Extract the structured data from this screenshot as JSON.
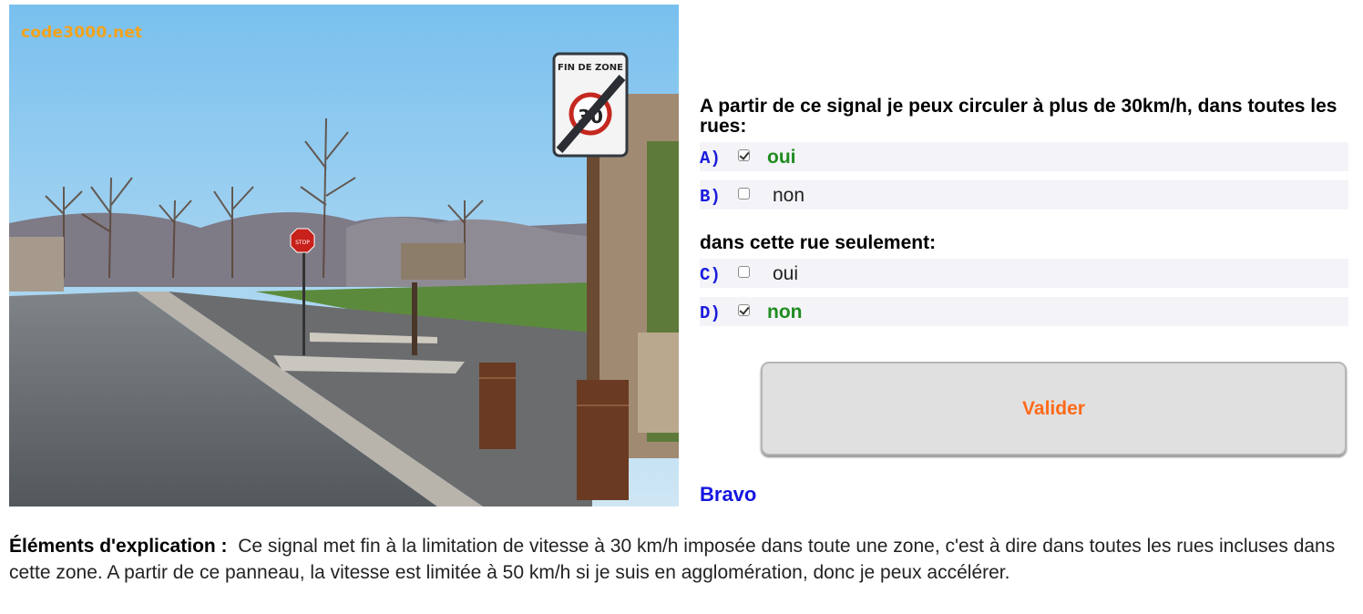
{
  "image": {
    "watermark": "code3000.net",
    "sign_top_text": "FIN DE ZONE",
    "sign_number": "30",
    "stop_sign_text": "STOP"
  },
  "question1": {
    "title": "A partir de ce signal je peux circuler à plus de 30km/h, dans toutes les rues:",
    "options": [
      {
        "letter": "A)",
        "label": "oui",
        "checked": true,
        "correct": true
      },
      {
        "letter": "B)",
        "label": "non",
        "checked": false,
        "correct": false
      }
    ]
  },
  "question2": {
    "title": "dans cette rue seulement:",
    "options": [
      {
        "letter": "C)",
        "label": "oui",
        "checked": false,
        "correct": false
      },
      {
        "letter": "D)",
        "label": "non",
        "checked": true,
        "correct": true
      }
    ]
  },
  "submit": {
    "label": "Valider"
  },
  "result": {
    "text": "Bravo"
  },
  "explanation": {
    "heading": "Éléments d'explication :",
    "text": "Ce signal met fin à la limitation de vitesse à 30 km/h imposée dans toute une zone, c'est à dire dans toutes les rues incluses dans cette zone. A partir de ce panneau, la vitesse est limitée à 50 km/h si je suis en agglomération, donc je peux accélérer."
  },
  "colors": {
    "correct": "#1f8c1f",
    "letter": "#1a1add",
    "button_text": "#ff6a1a",
    "result": "#1515e0"
  }
}
